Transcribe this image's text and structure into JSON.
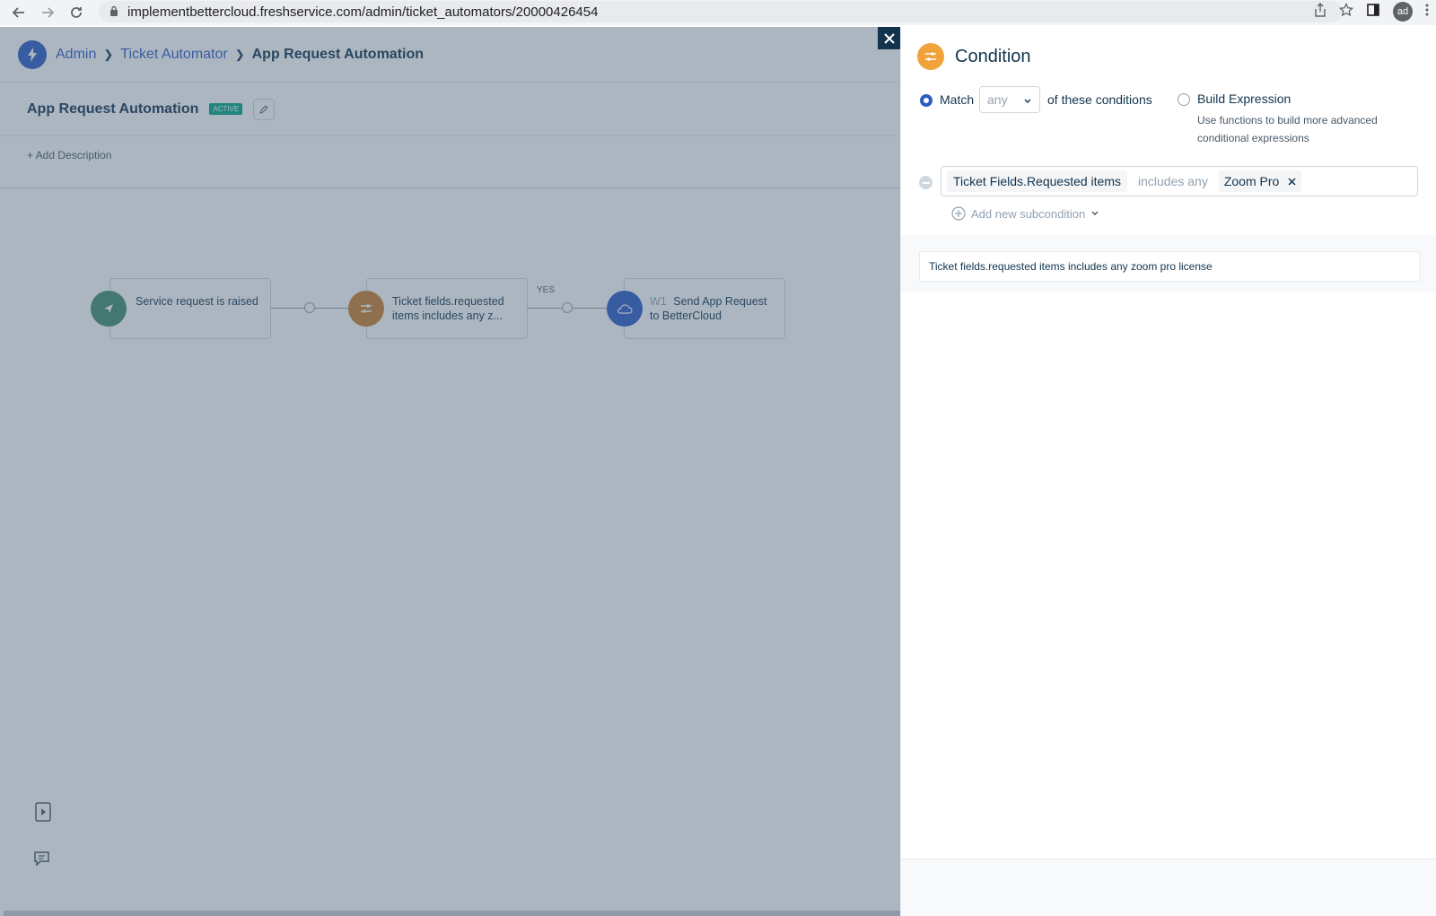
{
  "browser": {
    "url": "implementbettercloud.freshservice.com/admin/ticket_automators/20000426454",
    "profile_initials": "ad"
  },
  "breadcrumb": {
    "items": [
      "Admin",
      "Ticket Automator",
      "App Request Automation"
    ]
  },
  "automation": {
    "title": "App Request Automation",
    "status": "ACTIVE",
    "add_description": "+ Add Description"
  },
  "workflow": {
    "nodes": [
      {
        "label": "Service request is raised",
        "icon": "send-icon"
      },
      {
        "label": "Ticket fields.requested items includes any z...",
        "icon": "condition-icon"
      },
      {
        "prefix": "W1",
        "label": "Send App Request to BetterCloud",
        "icon": "cloud-icon"
      }
    ],
    "branch_label": "YES"
  },
  "panel": {
    "title": "Condition",
    "match_label": "Match",
    "match_value": "any",
    "match_suffix": "of these conditions",
    "build_expression_label": "Build Expression",
    "build_expression_help": "Use functions to build more advanced conditional expressions",
    "condition": {
      "field": "Ticket Fields.Requested items",
      "operator": "includes any",
      "value": "Zoom Pro"
    },
    "add_subcondition": "Add new subcondition",
    "summary": "Ticket fields.requested items includes any zoom pro license"
  },
  "colors": {
    "primary": "#2c5cc5",
    "condition": "#f2a23b",
    "trigger": "#00a886",
    "overlay": "#485d76"
  }
}
